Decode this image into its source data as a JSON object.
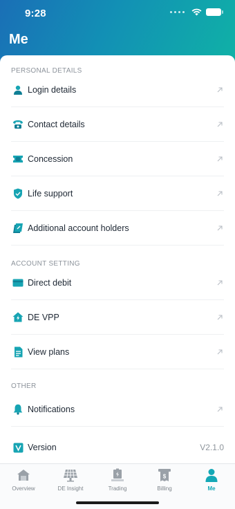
{
  "status_bar": {
    "time": "9:28"
  },
  "header": {
    "title": "Me"
  },
  "sections": {
    "personal": {
      "title": "PERSONAL DETAILS",
      "items": [
        {
          "label": "Login details",
          "icon": "user-icon"
        },
        {
          "label": "Contact details",
          "icon": "phone-icon"
        },
        {
          "label": "Concession",
          "icon": "ticket-icon"
        },
        {
          "label": "Life support",
          "icon": "shield-icon"
        },
        {
          "label": "Additional account holders",
          "icon": "users-icon"
        }
      ]
    },
    "account": {
      "title": "ACCOUNT SETTING",
      "items": [
        {
          "label": "Direct debit",
          "icon": "card-icon"
        },
        {
          "label": "DE VPP",
          "icon": "home-icon"
        },
        {
          "label": "View plans",
          "icon": "document-icon"
        }
      ]
    },
    "other": {
      "title": "OTHER",
      "items": [
        {
          "label": "Notifications",
          "icon": "bell-icon"
        },
        {
          "label": "Version",
          "icon": "version-icon",
          "value": "V2.1.0"
        }
      ]
    }
  },
  "tabbar": {
    "tabs": [
      {
        "label": "Overview",
        "icon": "house-icon"
      },
      {
        "label": "DE Insight",
        "icon": "solar-panel-icon"
      },
      {
        "label": "Trading",
        "icon": "battery-icon"
      },
      {
        "label": "Billing",
        "icon": "bill-icon"
      },
      {
        "label": "Me",
        "icon": "person-icon",
        "active": true
      }
    ]
  },
  "colors": {
    "accent": "#14a8b6",
    "header_start": "#1a6fb6",
    "header_end": "#10b2a6"
  }
}
